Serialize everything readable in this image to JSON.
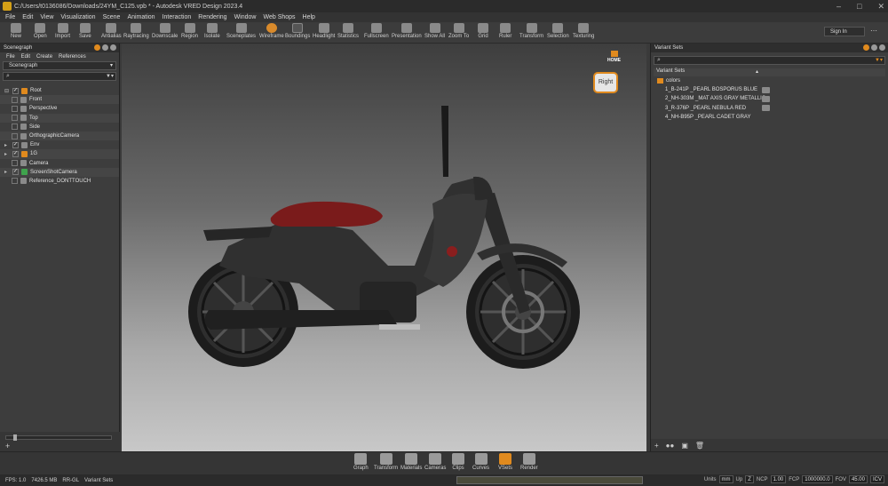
{
  "window": {
    "title": "C:/Users/t0136086/Downloads/24YM_C125.vpb * - Autodesk VRED Design 2023.4",
    "controls": [
      "–",
      "□",
      "✕"
    ]
  },
  "menubar": [
    "File",
    "Edit",
    "View",
    "Visualization",
    "Scene",
    "Animation",
    "Interaction",
    "Rendering",
    "Window",
    "Web Shops",
    "Help"
  ],
  "toolbar": {
    "items": [
      "New",
      "Open",
      "Import",
      "Save",
      "Antialias",
      "Raytracing",
      "Downscale",
      "Region",
      "Isolate",
      "Sceneplates",
      "Wireframe",
      "Boundings",
      "Headlight",
      "Statistics",
      "Fullscreen",
      "Presentation",
      "Show All",
      "Zoom To",
      "Grid",
      "Ruler",
      "Transform",
      "Selection",
      "Texturing"
    ],
    "signin": "Sign In",
    "more": "⋯"
  },
  "scenegraph": {
    "header": "Scenegraph",
    "menu": [
      "File",
      "Edit",
      "Create",
      "References"
    ],
    "selector": "Scenegraph",
    "tree": [
      {
        "label": "Root",
        "expanded": true,
        "checked": true,
        "icon": "orange"
      },
      {
        "label": "Front",
        "checked": false,
        "icon": "gray"
      },
      {
        "label": "Perspective",
        "checked": false,
        "icon": "gray"
      },
      {
        "label": "Top",
        "checked": false,
        "icon": "gray"
      },
      {
        "label": "Side",
        "checked": false,
        "icon": "gray"
      },
      {
        "label": "OrthographicCamera",
        "checked": false,
        "icon": "gray"
      },
      {
        "label": "Env",
        "checked": true,
        "icon": "gray"
      },
      {
        "label": "1G",
        "checked": true,
        "icon": "orange"
      },
      {
        "label": "Camera",
        "checked": false,
        "icon": "gray"
      },
      {
        "label": "ScreenShotCamera",
        "checked": true,
        "icon": "green"
      },
      {
        "label": "Reference_DONTTOUCH",
        "checked": false,
        "icon": "gray"
      }
    ]
  },
  "viewport": {
    "navcube_label": "Right",
    "home_label": "HOME"
  },
  "variant_sets": {
    "header": "Variant Sets",
    "column_header": "Variant Sets",
    "group": "colors",
    "items": [
      "1_B-241P _PEARL BOSPORUS BLUE",
      "2_NH-303M _MAT AXIS GRAY METALLIC",
      "3_R-376P _PEARL NEBULA RED",
      "4_NH-B95P _PEARL CADET GRAY"
    ],
    "footer_icons": [
      "+",
      "●●",
      "▣",
      "🗑"
    ]
  },
  "modules": [
    {
      "label": "Graph",
      "active": false
    },
    {
      "label": "Transform",
      "active": false
    },
    {
      "label": "Materials",
      "active": false
    },
    {
      "label": "Cameras",
      "active": false
    },
    {
      "label": "Clips",
      "active": false
    },
    {
      "label": "Curves",
      "active": false
    },
    {
      "label": "VSets",
      "active": true
    },
    {
      "label": "Render",
      "active": false
    }
  ],
  "statusbar": {
    "fps": "FPS: 1.0",
    "memory": "7426.5 MB",
    "renderer": "RR-GL",
    "module": "Variant Sets",
    "units_label": "Units",
    "units_value": "mm",
    "up_label": "Up",
    "up_value": "Z",
    "ncp_label": "NCP",
    "ncp_value": "1.00",
    "fcp_label": "FCP",
    "fcp_value": "1000000.0",
    "fov_label": "FOV",
    "fov_value": "45.00",
    "icv_label": "ICV"
  },
  "colors": {
    "accent": "#e08a1e",
    "panel_bg": "#3d3d3d",
    "title_bg": "#2b2b2b"
  }
}
